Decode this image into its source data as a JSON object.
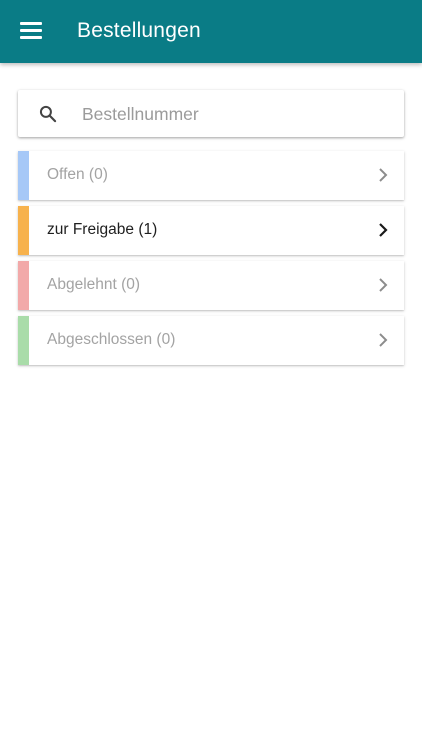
{
  "header": {
    "title": "Bestellungen",
    "menu_icon": "menu-icon",
    "background_color": "#0a7c86"
  },
  "search": {
    "placeholder": "Bestellnummer",
    "value": "",
    "icon": "search-icon"
  },
  "status_list": [
    {
      "label": "Offen (0)",
      "color": "#a6c8f7",
      "active": false,
      "icon": "chevron-right-icon"
    },
    {
      "label": "zur Freigabe (1)",
      "color": "#f7b24d",
      "active": true,
      "icon": "chevron-right-icon"
    },
    {
      "label": "Abgelehnt (0)",
      "color": "#f2a9a9",
      "active": false,
      "icon": "chevron-right-icon"
    },
    {
      "label": "Abgeschlossen (0)",
      "color": "#a9dca9",
      "active": false,
      "icon": "chevron-right-icon"
    }
  ]
}
